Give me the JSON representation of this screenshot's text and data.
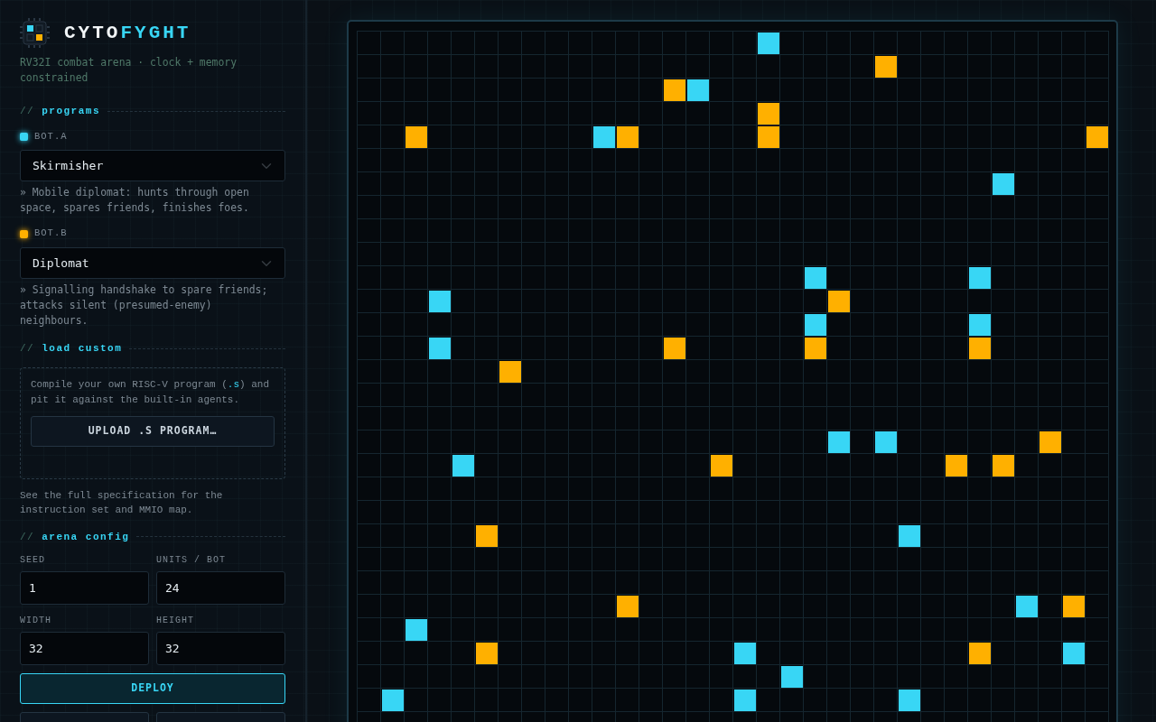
{
  "brand": {
    "prefix": "CYTO",
    "suffix": "FYGHT",
    "tagline": "RV32I combat arena · clock + memory constrained"
  },
  "programs": {
    "marker": "//",
    "heading": "programs",
    "bots": [
      {
        "label": "BOT.A",
        "color": "#38d6f5",
        "program": "Skirmisher",
        "description": "» Mobile diplomat: hunts through open space, spares friends, finishes foes."
      },
      {
        "label": "BOT.B",
        "color": "#ffb000",
        "program": "Diplomat",
        "description": "» Signalling handshake to spare friends; attacks silent (presumed-enemy) neighbours."
      }
    ]
  },
  "load_custom": {
    "marker": "//",
    "heading": "load custom",
    "note": {
      "before": "Compile your own RISC-V program (",
      "code": ".s",
      "after": ") and pit it against the built-in agents."
    },
    "upload_button": "UPLOAD .S PROGRAM…"
  },
  "spec_note": {
    "before": "See the ",
    "link": "full specification",
    "after": " for the instruction set and MMIO map."
  },
  "arena_config": {
    "marker": "//",
    "heading": "arena config",
    "fields": [
      {
        "label": "SEED",
        "value": "1"
      },
      {
        "label": "UNITS / BOT",
        "value": "24"
      },
      {
        "label": "WIDTH",
        "value": "32"
      },
      {
        "label": "HEIGHT",
        "value": "32"
      }
    ],
    "buttons": [
      {
        "label": "DEPLOY",
        "kind": "primary"
      },
      {
        "kind": "secondary"
      },
      {
        "kind": "secondary"
      }
    ]
  },
  "arena": {
    "rows": [
      {
        "kind": "units",
        "cells": [
          {
            "kind": "empty"
          },
          {
            "kind": "empty"
          },
          {
            "kind": "empty"
          },
          {
            "kind": "empty"
          },
          {
            "kind": "empty"
          },
          {
            "kind": "empty"
          },
          {
            "kind": "empty"
          },
          {
            "kind": "empty"
          },
          {
            "kind": "empty"
          },
          {
            "kind": "empty"
          },
          {
            "kind": "empty"
          },
          {
            "kind": "empty"
          },
          {
            "kind": "empty"
          },
          {
            "kind": "empty"
          },
          {
            "kind": "empty"
          },
          {
            "kind": "empty"
          },
          {
            "kind": "empty"
          },
          {
            "kind": "bot_a"
          }
        ]
      },
      {
        "kind": "units",
        "cells": [
          {
            "kind": "empty"
          },
          {
            "kind": "empty"
          },
          {
            "kind": "empty"
          },
          {
            "kind": "empty"
          },
          {
            "kind": "empty"
          },
          {
            "kind": "empty"
          },
          {
            "kind": "empty"
          },
          {
            "kind": "empty"
          },
          {
            "kind": "empty"
          },
          {
            "kind": "empty"
          },
          {
            "kind": "empty"
          },
          {
            "kind": "empty"
          },
          {
            "kind": "empty"
          },
          {
            "kind": "empty"
          },
          {
            "kind": "empty"
          },
          {
            "kind": "empty"
          },
          {
            "kind": "empty"
          },
          {
            "kind": "empty"
          },
          {
            "kind": "empty"
          },
          {
            "kind": "empty"
          },
          {
            "kind": "empty"
          },
          {
            "kind": "empty"
          },
          {
            "kind": "bot_b"
          }
        ]
      },
      {
        "kind": "units",
        "cells": [
          {
            "kind": "empty"
          },
          {
            "kind": "empty"
          },
          {
            "kind": "empty"
          },
          {
            "kind": "empty"
          },
          {
            "kind": "empty"
          },
          {
            "kind": "empty"
          },
          {
            "kind": "empty"
          },
          {
            "kind": "empty"
          },
          {
            "kind": "empty"
          },
          {
            "kind": "empty"
          },
          {
            "kind": "empty"
          },
          {
            "kind": "empty"
          },
          {
            "kind": "empty"
          },
          {
            "kind": "bot_b"
          },
          {
            "kind": "bot_a"
          }
        ]
      },
      {
        "kind": "units",
        "cells": [
          {
            "kind": "empty"
          },
          {
            "kind": "empty"
          },
          {
            "kind": "empty"
          },
          {
            "kind": "empty"
          },
          {
            "kind": "empty"
          },
          {
            "kind": "empty"
          },
          {
            "kind": "empty"
          },
          {
            "kind": "empty"
          },
          {
            "kind": "empty"
          },
          {
            "kind": "empty"
          },
          {
            "kind": "empty"
          },
          {
            "kind": "empty"
          },
          {
            "kind": "empty"
          },
          {
            "kind": "empty"
          },
          {
            "kind": "empty"
          },
          {
            "kind": "empty"
          },
          {
            "kind": "empty"
          },
          {
            "kind": "bot_b"
          }
        ]
      },
      {
        "kind": "units",
        "cells": [
          {
            "kind": "empty"
          },
          {
            "kind": "empty"
          },
          {
            "kind": "bot_b"
          },
          {
            "kind": "empty"
          },
          {
            "kind": "empty"
          },
          {
            "kind": "empty"
          },
          {
            "kind": "empty"
          },
          {
            "kind": "empty"
          },
          {
            "kind": "empty"
          },
          {
            "kind": "empty"
          },
          {
            "kind": "bot_a"
          },
          {
            "kind": "bot_b"
          },
          {
            "kind": "empty"
          },
          {
            "kind": "empty"
          },
          {
            "kind": "empty"
          },
          {
            "kind": "empty"
          },
          {
            "kind": "empty"
          },
          {
            "kind": "bot_b"
          },
          {
            "kind": "empty"
          },
          {
            "kind": "empty"
          },
          {
            "kind": "empty"
          },
          {
            "kind": "empty"
          },
          {
            "kind": "empty"
          },
          {
            "kind": "empty"
          },
          {
            "kind": "empty"
          },
          {
            "kind": "empty"
          },
          {
            "kind": "empty"
          },
          {
            "kind": "empty"
          },
          {
            "kind": "empty"
          },
          {
            "kind": "empty"
          },
          {
            "kind": "empty"
          },
          {
            "kind": "bot_b"
          }
        ]
      },
      {
        "kind": "empty"
      },
      {
        "kind": "units",
        "cells": [
          {
            "kind": "empty"
          },
          {
            "kind": "empty"
          },
          {
            "kind": "empty"
          },
          {
            "kind": "empty"
          },
          {
            "kind": "empty"
          },
          {
            "kind": "empty"
          },
          {
            "kind": "empty"
          },
          {
            "kind": "empty"
          },
          {
            "kind": "empty"
          },
          {
            "kind": "empty"
          },
          {
            "kind": "empty"
          },
          {
            "kind": "empty"
          },
          {
            "kind": "empty"
          },
          {
            "kind": "empty"
          },
          {
            "kind": "empty"
          },
          {
            "kind": "empty"
          },
          {
            "kind": "empty"
          },
          {
            "kind": "empty"
          },
          {
            "kind": "empty"
          },
          {
            "kind": "empty"
          },
          {
            "kind": "empty"
          },
          {
            "kind": "empty"
          },
          {
            "kind": "empty"
          },
          {
            "kind": "empty"
          },
          {
            "kind": "empty"
          },
          {
            "kind": "empty"
          },
          {
            "kind": "empty"
          },
          {
            "kind": "bot_a"
          }
        ]
      },
      {
        "kind": "empty"
      },
      {
        "kind": "empty"
      },
      {
        "kind": "empty"
      },
      {
        "kind": "units",
        "cells": [
          {
            "kind": "empty"
          },
          {
            "kind": "empty"
          },
          {
            "kind": "empty"
          },
          {
            "kind": "empty"
          },
          {
            "kind": "empty"
          },
          {
            "kind": "empty"
          },
          {
            "kind": "empty"
          },
          {
            "kind": "empty"
          },
          {
            "kind": "empty"
          },
          {
            "kind": "empty"
          },
          {
            "kind": "empty"
          },
          {
            "kind": "empty"
          },
          {
            "kind": "empty"
          },
          {
            "kind": "empty"
          },
          {
            "kind": "empty"
          },
          {
            "kind": "empty"
          },
          {
            "kind": "empty"
          },
          {
            "kind": "empty"
          },
          {
            "kind": "empty"
          },
          {
            "kind": "bot_a"
          },
          {
            "kind": "empty"
          },
          {
            "kind": "empty"
          },
          {
            "kind": "empty"
          },
          {
            "kind": "empty"
          },
          {
            "kind": "empty"
          },
          {
            "kind": "empty"
          },
          {
            "kind": "bot_a"
          }
        ]
      },
      {
        "kind": "units",
        "cells": [
          {
            "kind": "empty"
          },
          {
            "kind": "empty"
          },
          {
            "kind": "empty"
          },
          {
            "kind": "bot_a"
          },
          {
            "kind": "empty"
          },
          {
            "kind": "empty"
          },
          {
            "kind": "empty"
          },
          {
            "kind": "empty"
          },
          {
            "kind": "empty"
          },
          {
            "kind": "empty"
          },
          {
            "kind": "empty"
          },
          {
            "kind": "empty"
          },
          {
            "kind": "empty"
          },
          {
            "kind": "empty"
          },
          {
            "kind": "empty"
          },
          {
            "kind": "empty"
          },
          {
            "kind": "empty"
          },
          {
            "kind": "empty"
          },
          {
            "kind": "empty"
          },
          {
            "kind": "empty"
          },
          {
            "kind": "bot_b"
          }
        ]
      },
      {
        "kind": "units",
        "cells": [
          {
            "kind": "empty"
          },
          {
            "kind": "empty"
          },
          {
            "kind": "empty"
          },
          {
            "kind": "empty"
          },
          {
            "kind": "empty"
          },
          {
            "kind": "empty"
          },
          {
            "kind": "empty"
          },
          {
            "kind": "empty"
          },
          {
            "kind": "empty"
          },
          {
            "kind": "empty"
          },
          {
            "kind": "empty"
          },
          {
            "kind": "empty"
          },
          {
            "kind": "empty"
          },
          {
            "kind": "empty"
          },
          {
            "kind": "empty"
          },
          {
            "kind": "empty"
          },
          {
            "kind": "empty"
          },
          {
            "kind": "empty"
          },
          {
            "kind": "empty"
          },
          {
            "kind": "bot_a"
          },
          {
            "kind": "empty"
          },
          {
            "kind": "empty"
          },
          {
            "kind": "empty"
          },
          {
            "kind": "empty"
          },
          {
            "kind": "empty"
          },
          {
            "kind": "empty"
          },
          {
            "kind": "bot_a"
          }
        ]
      },
      {
        "kind": "units",
        "cells": [
          {
            "kind": "empty"
          },
          {
            "kind": "empty"
          },
          {
            "kind": "empty"
          },
          {
            "kind": "bot_a"
          },
          {
            "kind": "empty"
          },
          {
            "kind": "empty"
          },
          {
            "kind": "empty"
          },
          {
            "kind": "empty"
          },
          {
            "kind": "empty"
          },
          {
            "kind": "empty"
          },
          {
            "kind": "empty"
          },
          {
            "kind": "empty"
          },
          {
            "kind": "empty"
          },
          {
            "kind": "bot_b"
          },
          {
            "kind": "empty"
          },
          {
            "kind": "empty"
          },
          {
            "kind": "empty"
          },
          {
            "kind": "empty"
          },
          {
            "kind": "empty"
          },
          {
            "kind": "bot_b"
          },
          {
            "kind": "empty"
          },
          {
            "kind": "empty"
          },
          {
            "kind": "empty"
          },
          {
            "kind": "empty"
          },
          {
            "kind": "empty"
          },
          {
            "kind": "empty"
          },
          {
            "kind": "bot_b"
          }
        ]
      },
      {
        "kind": "units",
        "cells": [
          {
            "kind": "empty"
          },
          {
            "kind": "empty"
          },
          {
            "kind": "empty"
          },
          {
            "kind": "empty"
          },
          {
            "kind": "empty"
          },
          {
            "kind": "empty"
          },
          {
            "kind": "bot_b"
          }
        ]
      },
      {
        "kind": "empty"
      },
      {
        "kind": "empty"
      },
      {
        "kind": "units",
        "cells": [
          {
            "kind": "empty"
          },
          {
            "kind": "empty"
          },
          {
            "kind": "empty"
          },
          {
            "kind": "empty"
          },
          {
            "kind": "empty"
          },
          {
            "kind": "empty"
          },
          {
            "kind": "empty"
          },
          {
            "kind": "empty"
          },
          {
            "kind": "empty"
          },
          {
            "kind": "empty"
          },
          {
            "kind": "empty"
          },
          {
            "kind": "empty"
          },
          {
            "kind": "empty"
          },
          {
            "kind": "empty"
          },
          {
            "kind": "empty"
          },
          {
            "kind": "empty"
          },
          {
            "kind": "empty"
          },
          {
            "kind": "empty"
          },
          {
            "kind": "empty"
          },
          {
            "kind": "empty"
          },
          {
            "kind": "bot_a"
          },
          {
            "kind": "empty"
          },
          {
            "kind": "bot_a"
          },
          {
            "kind": "empty"
          },
          {
            "kind": "empty"
          },
          {
            "kind": "empty"
          },
          {
            "kind": "empty"
          },
          {
            "kind": "empty"
          },
          {
            "kind": "empty"
          },
          {
            "kind": "bot_b"
          }
        ]
      },
      {
        "kind": "units",
        "cells": [
          {
            "kind": "empty"
          },
          {
            "kind": "empty"
          },
          {
            "kind": "empty"
          },
          {
            "kind": "empty"
          },
          {
            "kind": "bot_a"
          },
          {
            "kind": "empty"
          },
          {
            "kind": "empty"
          },
          {
            "kind": "empty"
          },
          {
            "kind": "empty"
          },
          {
            "kind": "empty"
          },
          {
            "kind": "empty"
          },
          {
            "kind": "empty"
          },
          {
            "kind": "empty"
          },
          {
            "kind": "empty"
          },
          {
            "kind": "empty"
          },
          {
            "kind": "bot_b"
          },
          {
            "kind": "empty"
          },
          {
            "kind": "empty"
          },
          {
            "kind": "empty"
          },
          {
            "kind": "empty"
          },
          {
            "kind": "empty"
          },
          {
            "kind": "empty"
          },
          {
            "kind": "empty"
          },
          {
            "kind": "empty"
          },
          {
            "kind": "empty"
          },
          {
            "kind": "bot_b"
          },
          {
            "kind": "empty"
          },
          {
            "kind": "bot_b"
          }
        ]
      },
      {
        "kind": "empty"
      },
      {
        "kind": "empty"
      },
      {
        "kind": "units",
        "cells": [
          {
            "kind": "empty"
          },
          {
            "kind": "empty"
          },
          {
            "kind": "empty"
          },
          {
            "kind": "empty"
          },
          {
            "kind": "empty"
          },
          {
            "kind": "bot_b"
          },
          {
            "kind": "empty"
          },
          {
            "kind": "empty"
          },
          {
            "kind": "empty"
          },
          {
            "kind": "empty"
          },
          {
            "kind": "empty"
          },
          {
            "kind": "empty"
          },
          {
            "kind": "empty"
          },
          {
            "kind": "empty"
          },
          {
            "kind": "empty"
          },
          {
            "kind": "empty"
          },
          {
            "kind": "empty"
          },
          {
            "kind": "empty"
          },
          {
            "kind": "empty"
          },
          {
            "kind": "empty"
          },
          {
            "kind": "empty"
          },
          {
            "kind": "empty"
          },
          {
            "kind": "empty"
          },
          {
            "kind": "bot_a"
          }
        ]
      },
      {
        "kind": "empty"
      },
      {
        "kind": "empty"
      },
      {
        "kind": "units",
        "cells": [
          {
            "kind": "empty"
          },
          {
            "kind": "empty"
          },
          {
            "kind": "empty"
          },
          {
            "kind": "empty"
          },
          {
            "kind": "empty"
          },
          {
            "kind": "empty"
          },
          {
            "kind": "empty"
          },
          {
            "kind": "empty"
          },
          {
            "kind": "empty"
          },
          {
            "kind": "empty"
          },
          {
            "kind": "empty"
          },
          {
            "kind": "bot_b"
          },
          {
            "kind": "empty"
          },
          {
            "kind": "empty"
          },
          {
            "kind": "empty"
          },
          {
            "kind": "empty"
          },
          {
            "kind": "empty"
          },
          {
            "kind": "empty"
          },
          {
            "kind": "empty"
          },
          {
            "kind": "empty"
          },
          {
            "kind": "empty"
          },
          {
            "kind": "empty"
          },
          {
            "kind": "empty"
          },
          {
            "kind": "empty"
          },
          {
            "kind": "empty"
          },
          {
            "kind": "empty"
          },
          {
            "kind": "empty"
          },
          {
            "kind": "empty"
          },
          {
            "kind": "bot_a"
          },
          {
            "kind": "empty"
          },
          {
            "kind": "bot_b"
          }
        ]
      },
      {
        "kind": "units",
        "cells": [
          {
            "kind": "empty"
          },
          {
            "kind": "empty"
          },
          {
            "kind": "bot_a"
          }
        ]
      },
      {
        "kind": "units",
        "cells": [
          {
            "kind": "empty"
          },
          {
            "kind": "empty"
          },
          {
            "kind": "empty"
          },
          {
            "kind": "empty"
          },
          {
            "kind": "empty"
          },
          {
            "kind": "bot_b"
          },
          {
            "kind": "empty"
          },
          {
            "kind": "empty"
          },
          {
            "kind": "empty"
          },
          {
            "kind": "empty"
          },
          {
            "kind": "empty"
          },
          {
            "kind": "empty"
          },
          {
            "kind": "empty"
          },
          {
            "kind": "empty"
          },
          {
            "kind": "empty"
          },
          {
            "kind": "empty"
          },
          {
            "kind": "bot_a"
          },
          {
            "kind": "empty"
          },
          {
            "kind": "empty"
          },
          {
            "kind": "empty"
          },
          {
            "kind": "empty"
          },
          {
            "kind": "empty"
          },
          {
            "kind": "empty"
          },
          {
            "kind": "empty"
          },
          {
            "kind": "empty"
          },
          {
            "kind": "empty"
          },
          {
            "kind": "bot_b"
          },
          {
            "kind": "empty"
          },
          {
            "kind": "empty"
          },
          {
            "kind": "empty"
          },
          {
            "kind": "bot_a"
          }
        ]
      },
      {
        "kind": "units",
        "cells": [
          {
            "kind": "empty"
          },
          {
            "kind": "empty"
          },
          {
            "kind": "empty"
          },
          {
            "kind": "empty"
          },
          {
            "kind": "empty"
          },
          {
            "kind": "empty"
          },
          {
            "kind": "empty"
          },
          {
            "kind": "empty"
          },
          {
            "kind": "empty"
          },
          {
            "kind": "empty"
          },
          {
            "kind": "empty"
          },
          {
            "kind": "empty"
          },
          {
            "kind": "empty"
          },
          {
            "kind": "empty"
          },
          {
            "kind": "empty"
          },
          {
            "kind": "empty"
          },
          {
            "kind": "empty"
          },
          {
            "kind": "empty"
          },
          {
            "kind": "bot_a"
          }
        ]
      },
      {
        "kind": "units",
        "cells": [
          {
            "kind": "empty"
          },
          {
            "kind": "bot_a"
          },
          {
            "kind": "empty"
          },
          {
            "kind": "empty"
          },
          {
            "kind": "empty"
          },
          {
            "kind": "empty"
          },
          {
            "kind": "empty"
          },
          {
            "kind": "empty"
          },
          {
            "kind": "empty"
          },
          {
            "kind": "empty"
          },
          {
            "kind": "empty"
          },
          {
            "kind": "empty"
          },
          {
            "kind": "empty"
          },
          {
            "kind": "empty"
          },
          {
            "kind": "empty"
          },
          {
            "kind": "empty"
          },
          {
            "kind": "bot_a"
          },
          {
            "kind": "empty"
          },
          {
            "kind": "empty"
          },
          {
            "kind": "empty"
          },
          {
            "kind": "empty"
          },
          {
            "kind": "empty"
          },
          {
            "kind": "empty"
          },
          {
            "kind": "bot_a"
          }
        ]
      },
      {
        "kind": "empty"
      }
    ]
  }
}
